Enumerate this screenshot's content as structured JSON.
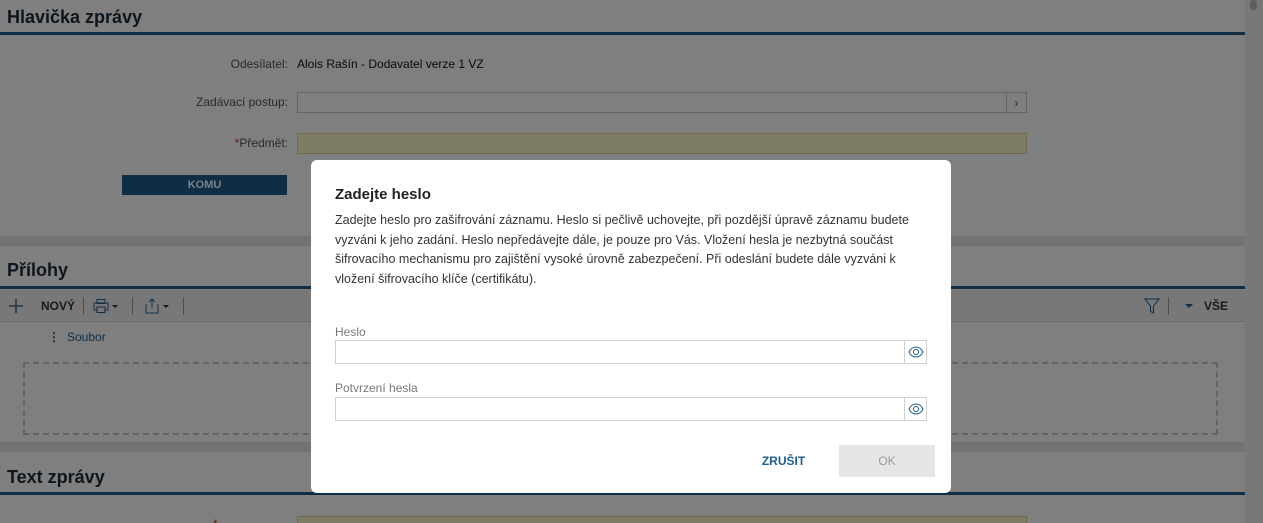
{
  "header_panel": {
    "title": "Hlavička zprávy",
    "sender_label": "Odesílatel:",
    "sender_value": "Alois Rašín - Dodavatel verze 1 VZ",
    "procedure_label": "Zadávací postup:",
    "procedure_value": "",
    "subject_required_mark": "*",
    "subject_label": "Předmět:",
    "subject_value": "",
    "komu_button": "KOMU"
  },
  "attachments_panel": {
    "title": "Přílohy",
    "new_label": "NOVÝ",
    "all_label": "VŠE",
    "column_file": "Soubor"
  },
  "text_panel": {
    "title": "Text zprávy",
    "required_mark": "*"
  },
  "modal": {
    "title": "Zadejte heslo",
    "description": "Zadejte heslo pro zašifrování záznamu. Heslo si pečlivě uchovejte, při pozdější úpravě záznamu budete vyzváni k jeho zadání. Heslo nepředávejte dále, je pouze pro Vás. Vložení hesla je nezbytná součást šifrovacího mechanismu pro zajištění vysoké úrovně zabezpečení. Při odeslání budete dále vyzváni k vložení šifrovacího klíče (certifikátu).",
    "password_label": "Heslo",
    "password_value": "",
    "confirm_label": "Potvrzení hesla",
    "confirm_value": "",
    "cancel_label": "ZRUŠIT",
    "ok_label": "OK"
  },
  "colors": {
    "accent": "#1f5d8c",
    "required": "#c0392b",
    "highlight_field": "#fcf6cc"
  }
}
